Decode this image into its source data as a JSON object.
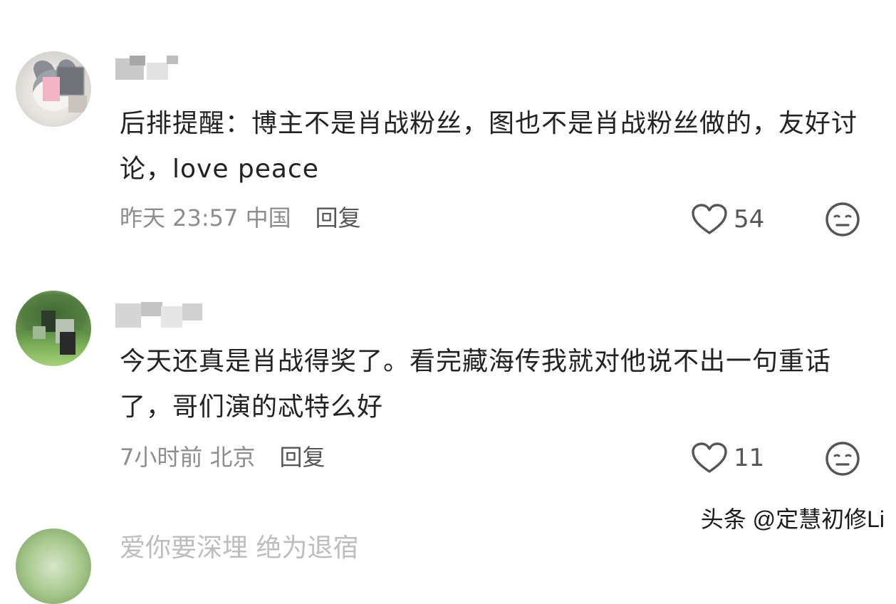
{
  "comments": [
    {
      "text": "后排提醒：博主不是肖战粉丝，图也不是肖战粉丝做的，友好讨论，love peace",
      "time_location": "昨天 23:57 中国",
      "reply_label": "回复",
      "like_count": "54"
    },
    {
      "text": "今天还真是肖战得奖了。看完藏海传我就对他说不出一句重话了，哥们演的忒特么好",
      "time_location": "7小时前 北京",
      "reply_label": "回复",
      "like_count": "11"
    },
    {
      "text": "爱你要深埋 绝为退宿"
    }
  ],
  "icons": {
    "like": "heart-outline-icon",
    "react": "meh-face-icon"
  },
  "colors": {
    "text": "#222222",
    "meta": "#8d8d8d",
    "icon": "#555555"
  },
  "watermark": "头条 @定慧初修Li"
}
